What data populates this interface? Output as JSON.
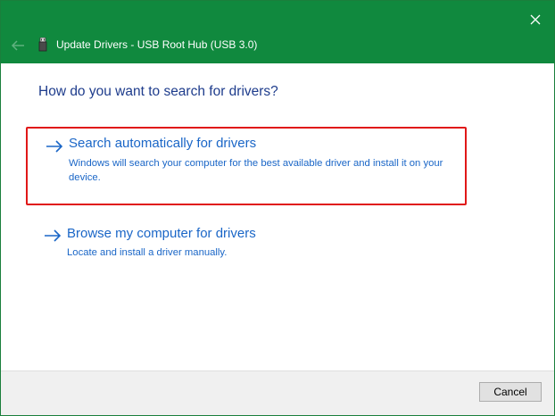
{
  "window": {
    "title": "Update Drivers - USB Root Hub (USB 3.0)"
  },
  "icons": {
    "close": "close-icon",
    "back": "back-arrow-icon",
    "device": "usb-device-icon",
    "option_arrow": "right-arrow-icon"
  },
  "colors": {
    "titlebar": "#10893e",
    "heading": "#1e3c8c",
    "link": "#1a66c7",
    "highlight_border": "#e01818",
    "footer": "#f0f0f0"
  },
  "main": {
    "heading": "How do you want to search for drivers?",
    "options": [
      {
        "title": "Search automatically for drivers",
        "description": "Windows will search your computer for the best available driver and install it on your device.",
        "highlighted": true
      },
      {
        "title": "Browse my computer for drivers",
        "description": "Locate and install a driver manually.",
        "highlighted": false
      }
    ]
  },
  "footer": {
    "cancel_label": "Cancel"
  }
}
